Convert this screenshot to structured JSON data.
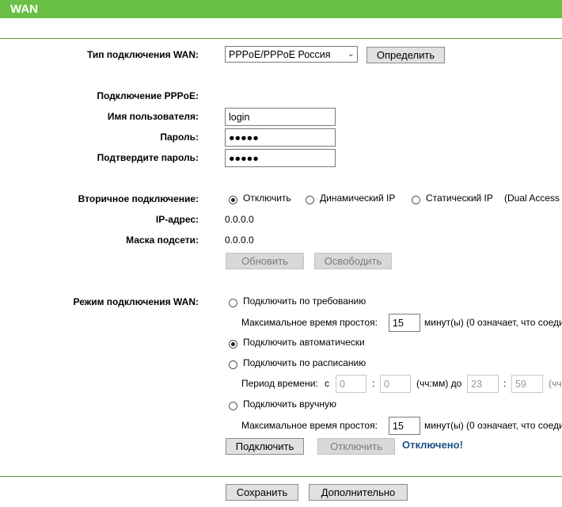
{
  "header": {
    "title": "WAN"
  },
  "wan_type": {
    "label": "Тип подключения WAN:",
    "selected": "PPPoE/PPPoE Россия",
    "detect_label": "Определить"
  },
  "pppoe": {
    "section_label": "Подключение PPPoE:",
    "username_label": "Имя пользователя:",
    "username_value": "login",
    "password_label": "Пароль:",
    "password_value": "●●●●●",
    "confirm_label": "Подтвердите пароль:",
    "confirm_value": "●●●●●"
  },
  "secondary": {
    "label": "Вторичное подключение:",
    "options": [
      "Отключить",
      "Динамический IP",
      "Статический IP"
    ],
    "selected_index": 0,
    "note": "(Dual Access"
  },
  "ip": {
    "label": "IP-адрес:",
    "value": "0.0.0.0"
  },
  "mask": {
    "label": "Маска подсети:",
    "value": "0.0.0.0"
  },
  "buttons": {
    "refresh": "Обновить",
    "release": "Освободить",
    "connect": "Подключить",
    "disconnect": "Отключить",
    "save": "Сохранить",
    "advanced": "Дополнительно"
  },
  "mode": {
    "label": "Режим подключения WAN:",
    "on_demand": "Подключить по требованию",
    "idle_label": "Максимальное время простоя:",
    "idle_value": "15",
    "idle_suffix": "минут(ы) (0 означает, что соеди",
    "auto": "Подключить автоматически",
    "schedule": "Подключить по расписанию",
    "period_label": "Период времени:",
    "from": "с",
    "h1": "0",
    "colon": ":",
    "m1": "0",
    "to_label": "(чч:мм) до",
    "h2": "23",
    "m2": "59",
    "tail": "(чч",
    "manual": "Подключить вручную",
    "idle2_label": "Максимальное время простоя:",
    "idle2_value": "15",
    "idle2_suffix": "минут(ы) (0 означает, что соеди",
    "selected": "auto"
  },
  "status": "Отключено!"
}
